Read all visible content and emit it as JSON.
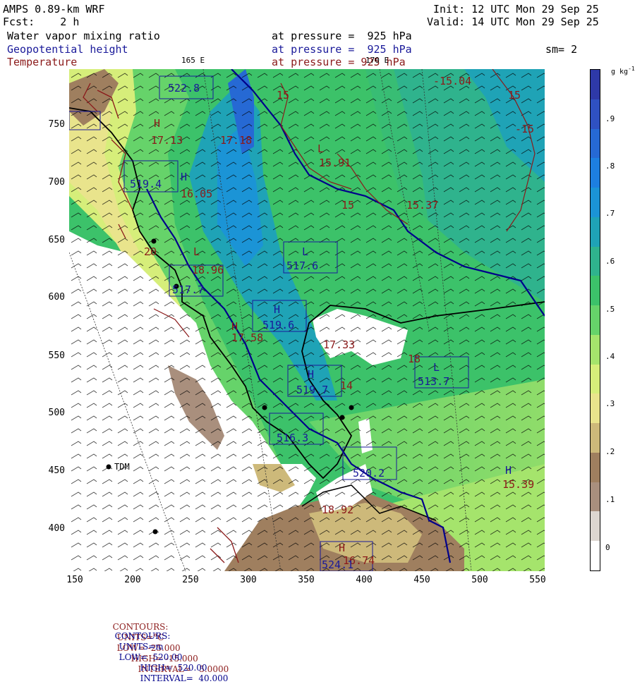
{
  "header": {
    "model": "AMPS 0.89-km WRF",
    "fcst": "Fcst:    2 h",
    "init": "Init: 12 UTC Mon 29 Sep 25",
    "valid": "Valid: 14 UTC Mon 29 Sep 25",
    "field1": "Water vapor mixing ratio",
    "field2": "Geopotential height",
    "field3": "Temperature",
    "level1": "at pressure =  925 hPa",
    "level2": "at pressure =  925 hPa",
    "level3": "at pressure = 925 hPa",
    "sm": "sm= 2",
    "lon1": "165 E",
    "lon2": "170 E"
  },
  "colors": {
    "moisture_ramp": [
      "#ffffff",
      "#ddd6d0",
      "#a98f7d",
      "#9f7f5f",
      "#cdb97a",
      "#e9e48c",
      "#d6ee7a",
      "#a5e46c",
      "#66d36a",
      "#3cc26a",
      "#2fb38d",
      "#1fa3b6",
      "#1b94d6",
      "#1d7fe0",
      "#2669d4",
      "#2f51c2",
      "#2e39a8"
    ],
    "contour_temp": "#8b1a1a",
    "contour_height": "#00008b"
  },
  "colorbar": {
    "unit": "g kg",
    "unit_exp": "-1",
    "labels": [
      ".9",
      ".8",
      ".7",
      ".6",
      ".5",
      ".4",
      ".3",
      ".2",
      ".1",
      "0"
    ]
  },
  "axes": {
    "x_ticks": [
      "150",
      "200",
      "250",
      "300",
      "350",
      "400",
      "450",
      "500",
      "550"
    ],
    "y_ticks": [
      "750",
      "700",
      "650",
      "600",
      "550",
      "500",
      "450",
      "400"
    ]
  },
  "labels": {
    "station": "TDM",
    "temp": [
      "-15.04",
      "15",
      "15",
      "-15",
      "L",
      "15.91",
      "15",
      "15.37",
      "17.13",
      "17.18",
      "16.05",
      "20",
      "18.96",
      "17.58",
      "17.33",
      "18",
      "16.74",
      "18.92",
      "15.39",
      "14"
    ],
    "height": [
      "522.8",
      "519.4",
      "517.6",
      "517.7",
      "519.6",
      "519.7",
      "513.7",
      "516.3",
      "520.2",
      "524.1"
    ],
    "hl": [
      "H",
      "H",
      "H",
      "H",
      "L",
      "L",
      "L",
      "H",
      "H",
      "H"
    ]
  },
  "footer": {
    "line1": {
      "c": "CONTOURS:",
      "u": "UNITS=°C",
      "lo": "LOW= -25.000",
      "hi": "HIGH= -15.000",
      "iv": "INTERVAL=   5.0000"
    },
    "line2": {
      "c": "CONTOURS:",
      "u": "UNITS=m",
      "lo": "LOW=  520.00",
      "hi": "HIGH=  520.00",
      "iv": "INTERVAL=  40.000"
    }
  }
}
